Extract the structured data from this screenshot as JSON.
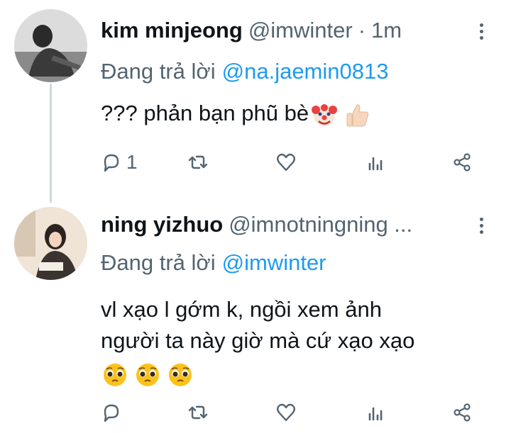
{
  "tweets": [
    {
      "name": "kim minjeong",
      "handle": "@imwinter",
      "separator": "·",
      "time": "1m",
      "reply_prefix": "Đang trả lời",
      "reply_to": "@na.jaemin0813",
      "text": "??? phản bạn phũ bè",
      "emojis": [
        "clown-face",
        "thumbs-up"
      ],
      "reply_count": "1"
    },
    {
      "name": "ning yizhuo",
      "handle": "@imnotningning ...",
      "reply_prefix": "Đang trả lời",
      "reply_to": "@imwinter",
      "text_line1": "vl xạo l gớm k, ngồi xem ảnh",
      "text_line2": "người ta này giờ mà cứ xạo xạo",
      "emojis": [
        "pleading-face",
        "pleading-face",
        "pleading-face"
      ]
    }
  ],
  "icons": [
    "reply-icon",
    "retweet-icon",
    "like-icon",
    "views-icon",
    "share-icon",
    "more-icon"
  ],
  "colors": {
    "accent": "#1d9bf0",
    "muted": "#536471",
    "text": "#0f1419"
  }
}
